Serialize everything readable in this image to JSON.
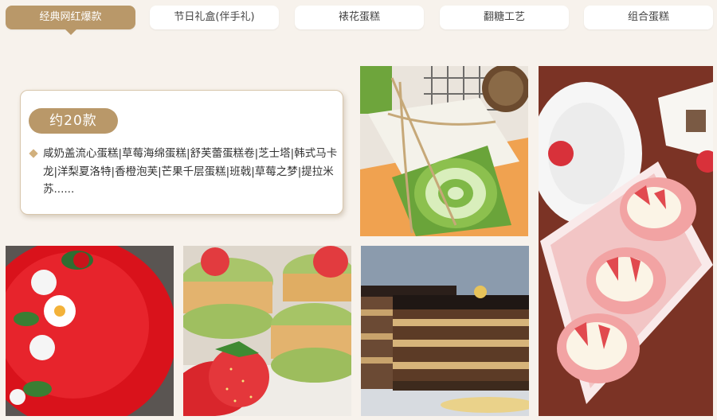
{
  "tabs": [
    {
      "label": "经典网红爆款",
      "active": true
    },
    {
      "label": "节日礼盒(伴手礼)",
      "active": false
    },
    {
      "label": "裱花蛋糕",
      "active": false
    },
    {
      "label": "翻糖工艺",
      "active": false
    },
    {
      "label": "组合蛋糕",
      "active": false
    }
  ],
  "feature": {
    "badge": "约20款",
    "description": "咸奶盖流心蛋糕|草莓海绵蛋糕|舒芙蕾蛋糕卷|芝士塔|韩式马卡龙|洋梨夏洛特|香橙泡芙|芒果千层蛋糕|班戟|草莓之梦|提拉米苏......"
  },
  "colors": {
    "page_bg": "#f7f2ec",
    "accent": "#b99869",
    "card_border": "#d8c6ac"
  }
}
